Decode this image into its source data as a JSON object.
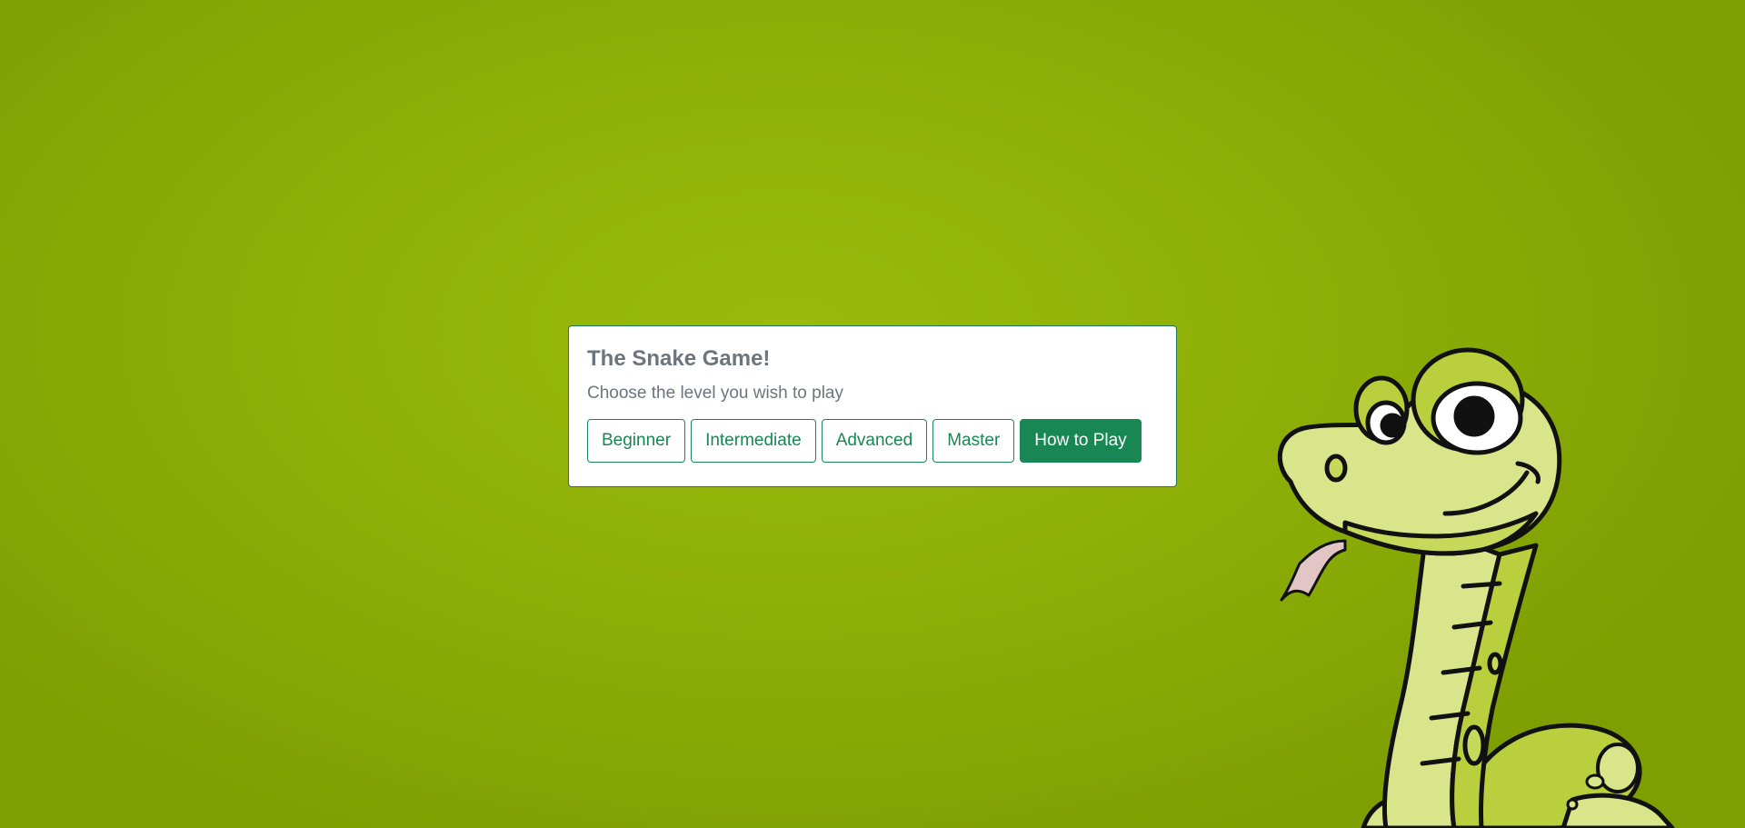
{
  "menu": {
    "title": "The Snake Game!",
    "subtitle": "Choose the level you wish to play",
    "levels": [
      {
        "label": "Beginner"
      },
      {
        "label": "Intermediate"
      },
      {
        "label": "Advanced"
      },
      {
        "label": "Master"
      }
    ],
    "help_label": "How to Play"
  },
  "colors": {
    "background": "#8fb008",
    "accent": "#198754",
    "text_muted": "#6c757d",
    "snake_body": "#d9e58a",
    "snake_outline": "#111111"
  },
  "decoration": {
    "icon": "cartoon-snake-icon"
  }
}
